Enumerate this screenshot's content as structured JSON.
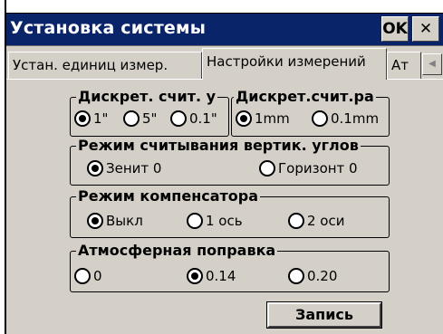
{
  "window": {
    "title": "Установка системы",
    "ok_label": "OK",
    "close_label": "✕"
  },
  "tabs": [
    {
      "label": "Устан. единиц измер.",
      "active": false
    },
    {
      "label": "Настройки измерений",
      "active": true
    },
    {
      "label": "Ат",
      "active": false
    }
  ],
  "groups": {
    "discrete_angle": {
      "label": "Дискрет. счит. у",
      "options": [
        {
          "label": "1\"",
          "selected": true
        },
        {
          "label": "5\"",
          "selected": false
        },
        {
          "label": "0.1\"",
          "selected": false
        }
      ]
    },
    "discrete_distance": {
      "label": "Дискрет.счит.ра",
      "options": [
        {
          "label": "1mm",
          "selected": true
        },
        {
          "label": "0.1mm",
          "selected": false
        }
      ]
    },
    "vertical_mode": {
      "label": "Режим считывания вертик. углов",
      "options": [
        {
          "label": "Зенит 0",
          "selected": true
        },
        {
          "label": "Горизонт 0",
          "selected": false
        }
      ]
    },
    "compensator": {
      "label": "Режим компенсатора",
      "options": [
        {
          "label": "Выкл",
          "selected": true
        },
        {
          "label": "1 ось",
          "selected": false
        },
        {
          "label": "2 оси",
          "selected": false
        }
      ]
    },
    "atmospheric": {
      "label": "Атмосферная поправка",
      "options": [
        {
          "label": "0",
          "selected": false
        },
        {
          "label": "0.14",
          "selected": true
        },
        {
          "label": "0.20",
          "selected": false
        }
      ]
    }
  },
  "save_label": "Запись",
  "colors": {
    "titlebar": "#0a246a",
    "face": "#d4d0c8"
  }
}
